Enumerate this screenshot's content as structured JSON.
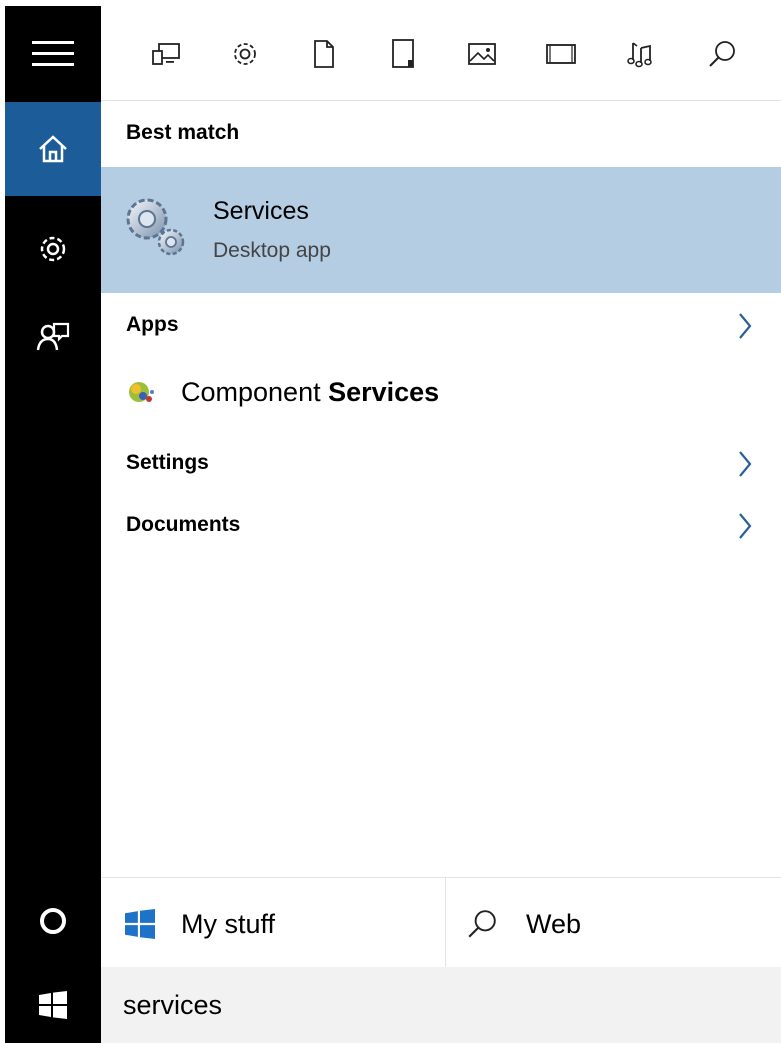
{
  "search": {
    "value": "services",
    "placeholder": ""
  },
  "filters": [
    {
      "icon": "apps-filter-icon"
    },
    {
      "icon": "settings-filter-icon"
    },
    {
      "icon": "documents-filter-icon"
    },
    {
      "icon": "folders-filter-icon"
    },
    {
      "icon": "photos-filter-icon"
    },
    {
      "icon": "videos-filter-icon"
    },
    {
      "icon": "music-filter-icon"
    },
    {
      "icon": "web-filter-icon"
    }
  ],
  "sections": {
    "best_match": "Best match",
    "apps": "Apps",
    "settings": "Settings",
    "documents": "Documents"
  },
  "best_match": {
    "title": "Services",
    "subtitle": "Desktop app"
  },
  "apps": [
    {
      "prefix": "Component ",
      "highlight": "Services"
    }
  ],
  "tabs": {
    "my_stuff": "My stuff",
    "web": "Web"
  },
  "colors": {
    "rail": "#000000",
    "rail_active": "#1c5c99",
    "selected_item": "#b4cde3",
    "search_box": "#f2f2f2"
  }
}
